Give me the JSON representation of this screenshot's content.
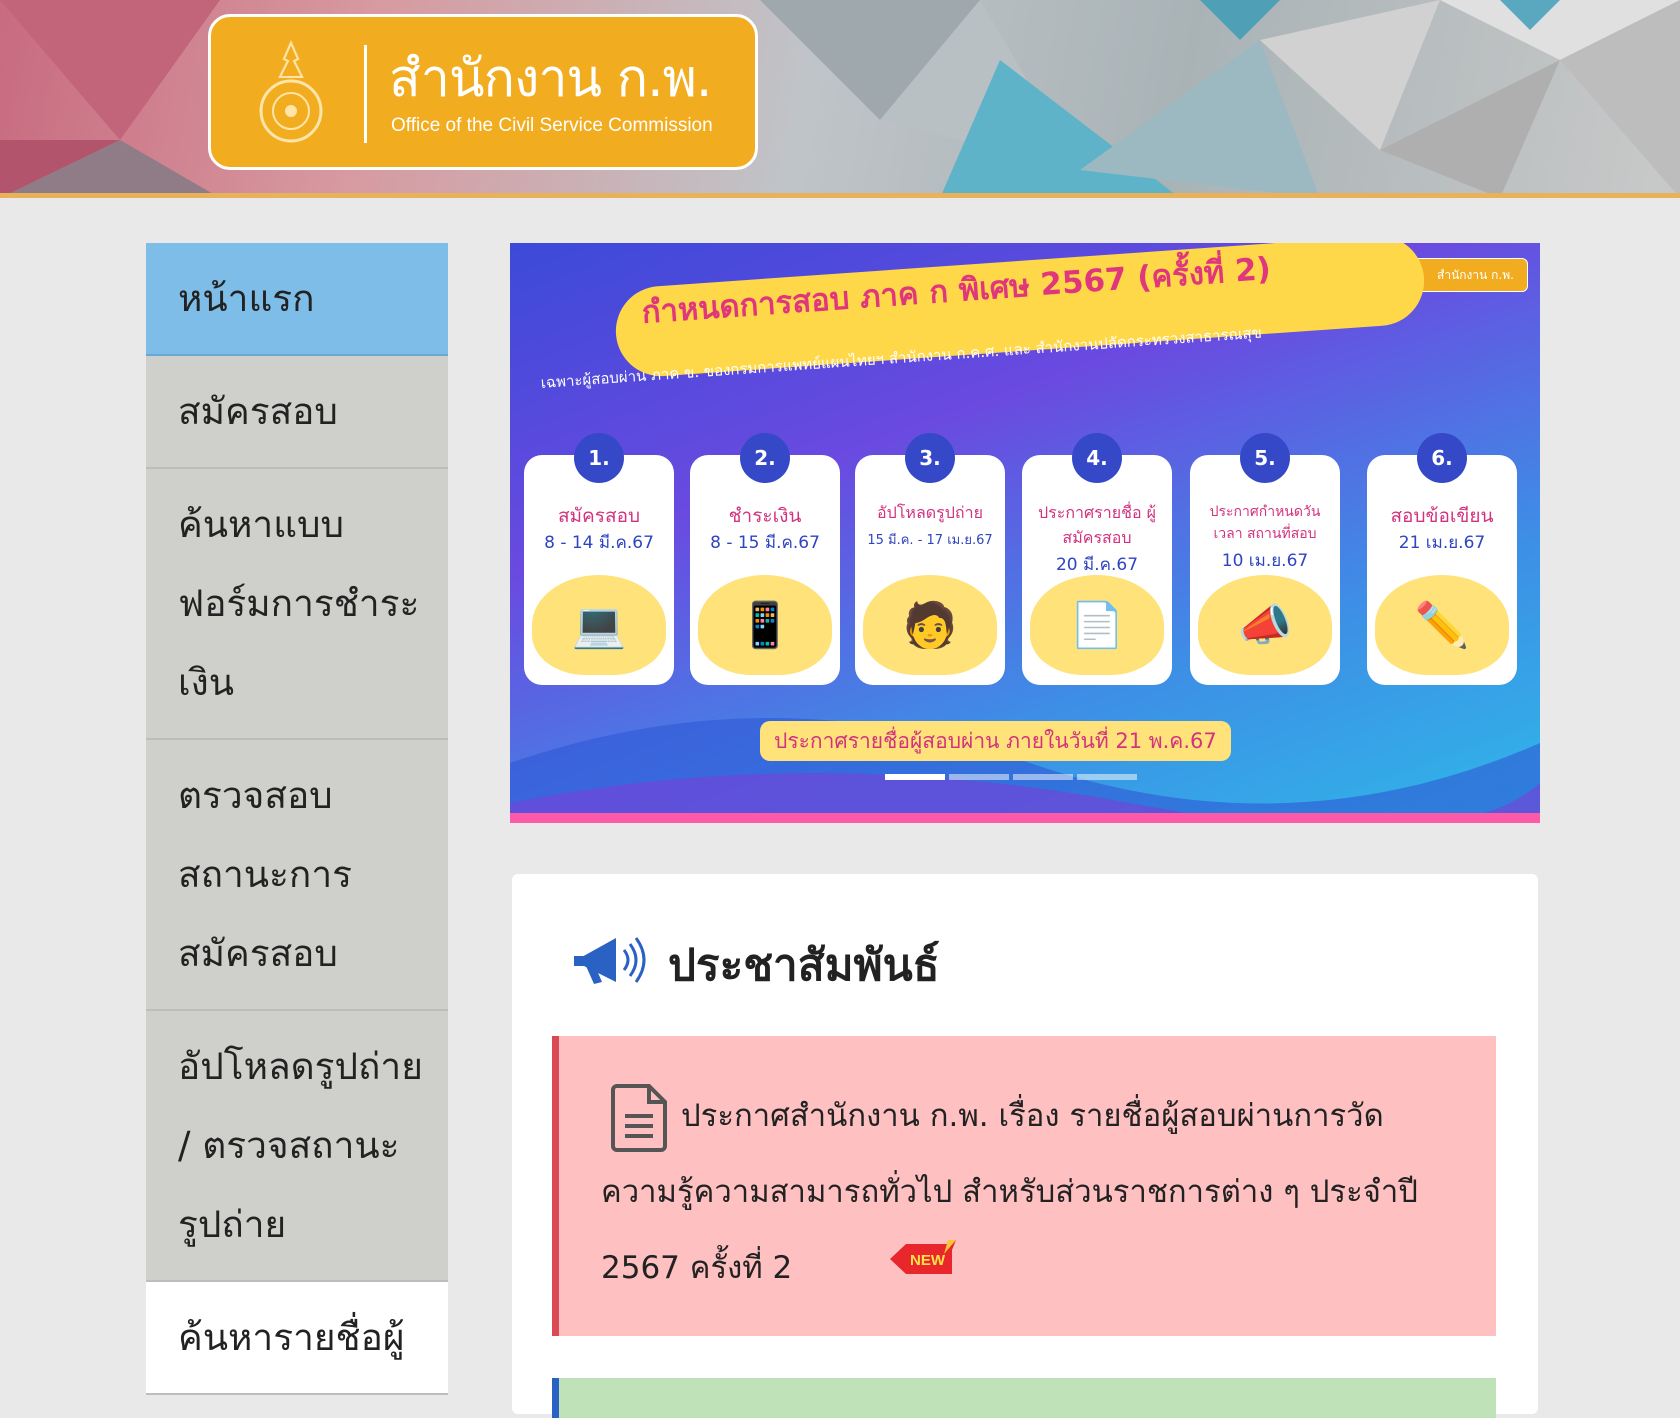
{
  "header": {
    "org_name_th": "สำนักงาน ก.พ.",
    "org_name_en": "Office of the Civil Service Commission"
  },
  "sidebar": {
    "items": [
      {
        "label": "หน้าแรก",
        "active": true
      },
      {
        "label": "สมัครสอบ"
      },
      {
        "label": "ค้นหาแบบฟอร์มการชำระเงิน"
      },
      {
        "label": "ตรวจสอบสถานะการสมัครสอบ"
      },
      {
        "label": "อัปโหลดรูปถ่าย / ตรวจสถานะรูปถ่าย"
      },
      {
        "label": "ค้นหารายชื่อผู้"
      }
    ]
  },
  "banner": {
    "mini_logo": "สำนักงาน ก.พ.",
    "title": "กำหนดการสอบ ภาค ก พิเศษ 2567 (ครั้งที่ 2)",
    "subtitle": "เฉพาะผู้สอบผ่าน ภาค ข. ของกรมการแพทย์แผนไทยฯ สำนักงาน ก.ค.ศ. และ สำนักงานปลัดกระทรวงสาธารณสุข",
    "steps": [
      {
        "num": "1.",
        "title": "สมัครสอบ",
        "date": "8 - 14 มี.ค.67",
        "icon": "laptop-icon",
        "glyph": "💻"
      },
      {
        "num": "2.",
        "title": "ชำระเงิน",
        "date": "8 - 15 มี.ค.67",
        "icon": "pay-phone-icon",
        "glyph": "📱"
      },
      {
        "num": "3.",
        "title": "อัปโหลดรูปถ่าย",
        "date": "15 มี.ค. - 17 เม.ย.67",
        "icon": "photo-upgrade-icon",
        "glyph": "🧑"
      },
      {
        "num": "4.",
        "title": "ประกาศรายชื่อ ผู้สมัครสอบ",
        "date": "20 มี.ค.67",
        "icon": "pdf-icon",
        "glyph": "📄"
      },
      {
        "num": "5.",
        "title": "ประกาศกำหนดวัน เวลา สถานที่สอบ",
        "date": "10 เม.ย.67",
        "icon": "megaphone-icon",
        "glyph": "📣"
      },
      {
        "num": "6.",
        "title": "สอบข้อเขียน",
        "date": "21 เม.ย.67",
        "icon": "pencil-icon",
        "glyph": "✏️"
      }
    ],
    "footer": "ประกาศรายชื่อผู้สอบผ่าน ภายในวันที่ 21 พ.ค.67"
  },
  "news": {
    "title": "ประชาสัมพันธ์",
    "items": [
      {
        "text": "ประกาศสำนักงาน ก.พ. เรื่อง รายชื่อผู้สอบผ่านการวัดความรู้ความสามารถทั่วไป สำหรับส่วนราชการต่าง ๆ ประจำปี 2567 ครั้งที่ 2",
        "badge": "NEW"
      }
    ]
  },
  "colors": {
    "brand": "#f2ac20",
    "nav_active": "#7dbde8",
    "nav_bg": "#cfcfcb",
    "alert_bg": "#ffc0c1",
    "alert_border": "#d94a54"
  }
}
